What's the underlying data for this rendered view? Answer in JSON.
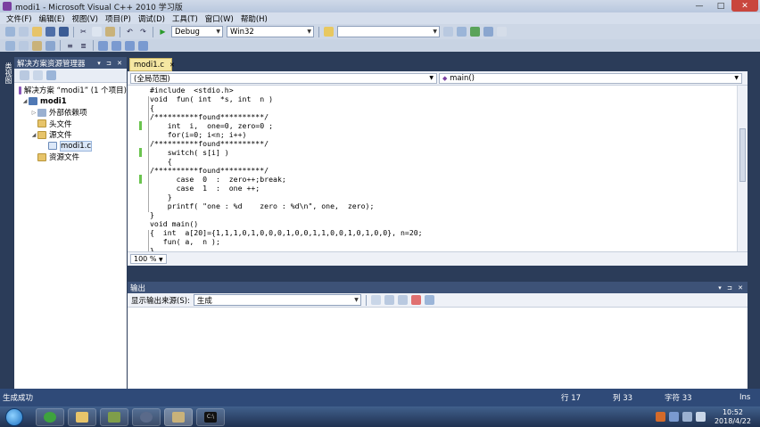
{
  "window": {
    "title": "modi1 - Microsoft Visual C++ 2010 学习版",
    "controls": [
      "—",
      "□",
      "✕"
    ]
  },
  "menu": [
    "文件(F)",
    "编辑(E)",
    "视图(V)",
    "项目(P)",
    "调试(D)",
    "工具(T)",
    "窗口(W)",
    "帮助(H)"
  ],
  "toolbar": {
    "config": "Debug",
    "platform": "Win32",
    "find_value": ""
  },
  "solution_explorer": {
    "title": "解决方案资源管理器",
    "header_controls": "▾ ⊐ ✕",
    "side_tab": "类视图",
    "items": [
      {
        "label": "解决方案 “modi1” (1 个项目)",
        "icon": "solution-icon",
        "level": 0
      },
      {
        "label": "modi1",
        "icon": "project-icon",
        "level": 1
      },
      {
        "label": "外部依赖项",
        "icon": "dependencies-icon",
        "level": 2
      },
      {
        "label": "头文件",
        "icon": "folder-icon",
        "level": 2
      },
      {
        "label": "源文件",
        "icon": "folder-icon",
        "level": 2
      },
      {
        "label": "modi1.c",
        "icon": "c-file-icon",
        "level": 3
      },
      {
        "label": "资源文件",
        "icon": "folder-icon",
        "level": 2
      }
    ]
  },
  "editor": {
    "tab": "modi1.c",
    "tab_close": "✕",
    "scope": "(全局范围)",
    "member": "main()",
    "zoom": "100 %",
    "lines": [
      "#include  <stdio.h>",
      "void  fun( int  *s, int  n )",
      "{",
      "/**********found**********/",
      "    int  i,  one=0, zero=0 ;",
      "    for(i=0; i<n; i++)",
      "/**********found**********/",
      "    switch( s[i] )",
      "    {",
      "/**********found**********/",
      "      case  0  :  zero++;break;",
      "      case  1  :  one ++;",
      "    }",
      "    printf( \"one : %d    zero : %d\\n\", one,  zero);",
      "}",
      "void main()",
      "{  int  a[20]={1,1,1,0,1,0,0,0,1,0,0,1,1,0,0,1,0,1,0,0}, n=20;",
      "   fun( a,  n );",
      "}"
    ]
  },
  "output": {
    "title": "输出",
    "header_controls": "▾ ⊐ ✕",
    "source_label": "显示输出来源(S):",
    "source_value": "生成"
  },
  "status": {
    "message": "生成成功",
    "line": "行 17",
    "col": "列 33",
    "char": "字符 33",
    "mode": "Ins"
  },
  "taskbar": {
    "time": "10:52",
    "date": "2018/4/22"
  }
}
